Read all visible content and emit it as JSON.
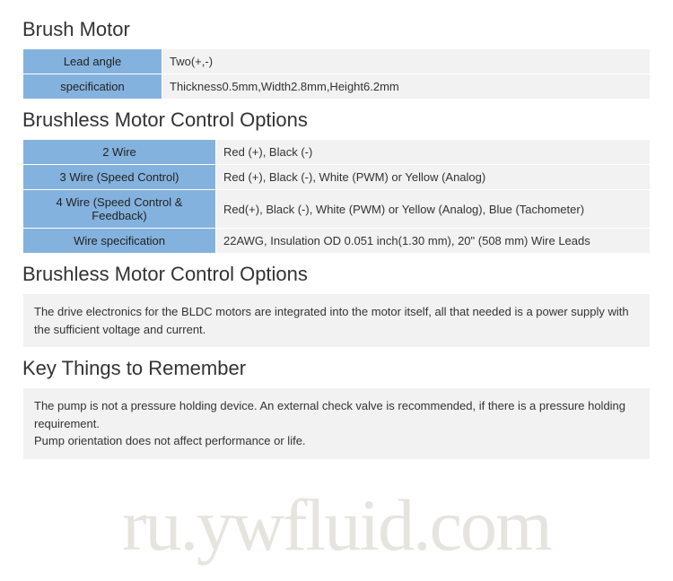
{
  "sections": {
    "brush_motor": {
      "title": "Brush Motor",
      "rows": [
        {
          "label": "Lead angle",
          "value": "Two(+,-)"
        },
        {
          "label": "specification",
          "value": "Thickness0.5mm,Width2.8mm,Height6.2mm"
        }
      ]
    },
    "brushless_options_table": {
      "title": "Brushless Motor Control Options",
      "rows": [
        {
          "label": "2 Wire",
          "value": "Red (+), Black (-)"
        },
        {
          "label": "3 Wire (Speed Control)",
          "value": "Red (+), Black (-), White (PWM) or Yellow (Analog)"
        },
        {
          "label": "4 Wire (Speed Control & Feedback)",
          "value": "Red(+), Black (-), White (PWM) or Yellow (Analog), Blue (Tachometer)"
        },
        {
          "label": "Wire specification",
          "value": "22AWG, Insulation OD 0.051 inch(1.30 mm), 20\" (508 mm) Wire Leads"
        }
      ]
    },
    "brushless_options_note": {
      "title": "Brushless Motor Control Options",
      "text": "The drive electronics for the BLDC motors are integrated into the motor itself, all that needed is a power supply with the sufficient voltage and current."
    },
    "key_things": {
      "title": "Key Things to Remember",
      "line1": "The pump is not a pressure holding device. An external check valve is recommended, if there is a pressure holding requirement.",
      "line2": "Pump orientation does not affect performance or life."
    }
  },
  "watermark": "ru.ywfluid.com"
}
